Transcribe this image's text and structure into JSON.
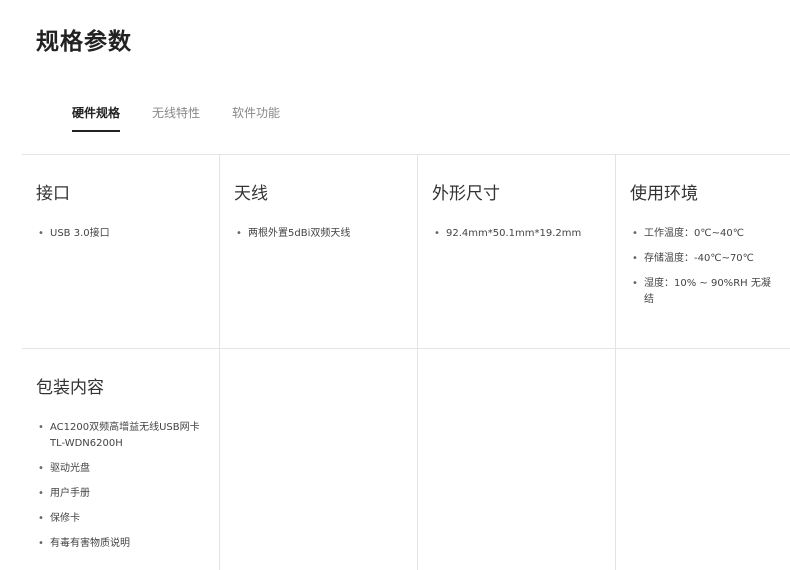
{
  "page": {
    "title": "规格参数"
  },
  "tabs": [
    {
      "label": "硬件规格",
      "active": true
    },
    {
      "label": "无线特性",
      "active": false
    },
    {
      "label": "软件功能",
      "active": false
    }
  ],
  "specs": {
    "interface": {
      "heading": "接口",
      "items": [
        "USB 3.0接口"
      ]
    },
    "antenna": {
      "heading": "天线",
      "items": [
        "两根外置5dBi双频天线"
      ]
    },
    "dimensions": {
      "heading": "外形尺寸",
      "items": [
        "92.4mm*50.1mm*19.2mm"
      ]
    },
    "environment": {
      "heading": "使用环境",
      "items": [
        "工作温度：0℃~40℃",
        "存储温度：-40℃~70℃",
        "湿度：10% ~ 90%RH 无凝结"
      ]
    },
    "package": {
      "heading": "包装内容",
      "items": [
        "AC1200双频高增益无线USB网卡 TL-WDN6200H",
        "驱动光盘",
        "用户手册",
        "保修卡",
        "有毒有害物质说明"
      ]
    }
  },
  "colors": {
    "border": "#e4e4e4",
    "title": "#222222",
    "tab_inactive": "#888888"
  }
}
